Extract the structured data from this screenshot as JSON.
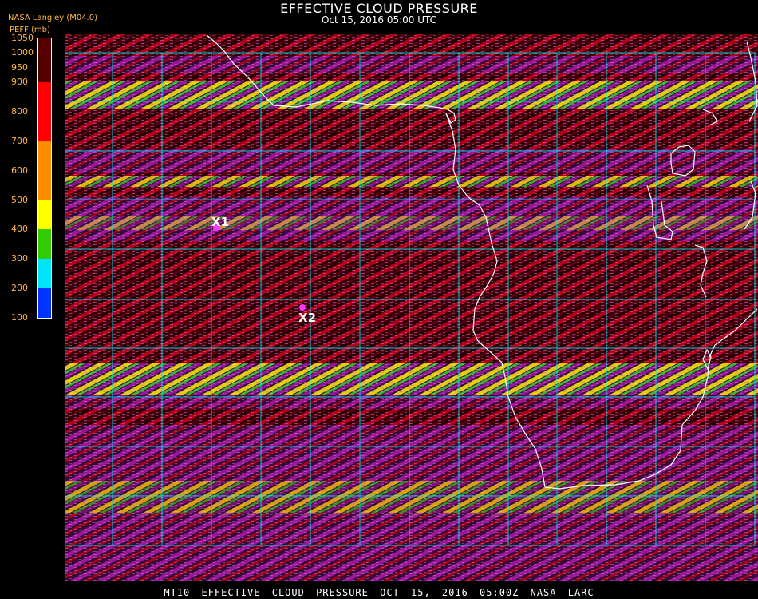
{
  "header": {
    "title": "EFFECTIVE CLOUD PRESSURE",
    "subtitle": "Oct 15, 2016 05:00 UTC",
    "org": "NASA Langley (M04.0)",
    "unit": "PEFF (mb)"
  },
  "legend": {
    "ticks": [
      "1050",
      "1000",
      "950",
      "900",
      "800",
      "700",
      "600",
      "500",
      "400",
      "300",
      "200",
      "100"
    ],
    "segments": [
      {
        "from": 100,
        "to": 200,
        "color": "#0033ff"
      },
      {
        "from": 200,
        "to": 300,
        "color": "#00e5ff"
      },
      {
        "from": 300,
        "to": 400,
        "color": "#33cc00"
      },
      {
        "from": 400,
        "to": 500,
        "color": "#ffff00"
      },
      {
        "from": 500,
        "to": 700,
        "color": "#ff8c00"
      },
      {
        "from": 700,
        "to": 900,
        "color": "#ff0000"
      },
      {
        "from": 900,
        "to": 1050,
        "color": "#550000"
      }
    ]
  },
  "markers": [
    {
      "label": "X1",
      "color": "#ff33ff"
    },
    {
      "label": "X2",
      "color": "#ff33ff"
    }
  ],
  "colors": {
    "grid": "#00e5ff",
    "coast": "#ffffff",
    "base": "#3a0008",
    "stripe_red": "#b3001a",
    "stripe_magenta": "#9a1aa8",
    "stripe_yellow": "#e6e600",
    "stripe_green": "#33cc33"
  },
  "footer": "MT10  EFFECTIVE CLOUD PRESSURE  OCT 15, 2016 05:00Z  NASA LARC"
}
